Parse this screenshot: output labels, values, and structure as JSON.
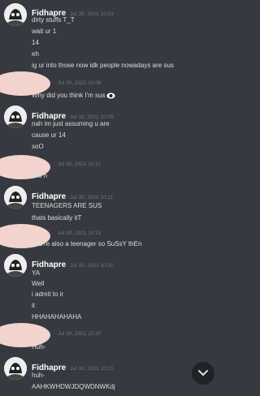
{
  "messages": [
    {
      "author": "Fidhapre",
      "time": "Jul 30, 2021 10:03",
      "lines": [
        "dirty stuffs T_T",
        "wait ur 1",
        "14",
        "eh",
        "ig ur into those now idk people nowadays are sus"
      ]
    },
    {
      "time": "Jul 30, 2021 10:08",
      "text": "Why did you think I'm sus",
      "icon": "eye-emoji-icon"
    },
    {
      "author": "Fidhapre",
      "time": "Jul 30, 2021 10:09",
      "lines": [
        "nah im just assuming u are",
        "cause ur 14",
        "soO"
      ]
    },
    {
      "time": "Jul 30, 2021 10:11",
      "text": "H u h"
    },
    {
      "author": "Fidhapre",
      "time": "Jul 30, 2021 10:11",
      "lines": [
        "TEENAGERS ARE SUS",
        "thats basically itT"
      ]
    },
    {
      "time": "Jul 30, 2021 10:13",
      "text": "You're also a teenager so SuSsY thEn"
    },
    {
      "author": "Fidhapre",
      "time": "Jul 30, 2021 10:20",
      "lines": [
        "YA",
        "Well",
        "i admit to ir",
        "it",
        "HHAHAHAHAHA"
      ]
    },
    {
      "time": "Jul 30, 2021 10:20",
      "text": "Huh-"
    },
    {
      "author": "Fidhapre",
      "time": "Jul 30, 2021 10:21",
      "lines": [
        "huh-",
        "AAHKWHDWJDQWDNWKdj"
      ]
    }
  ],
  "scroll_button": {
    "icon": "chevron-down-icon"
  }
}
